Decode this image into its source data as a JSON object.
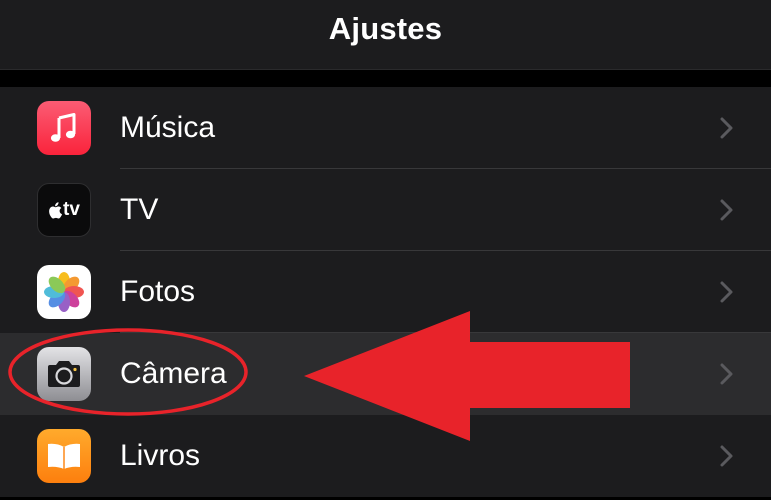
{
  "header": {
    "title": "Ajustes"
  },
  "settings": {
    "items": [
      {
        "label": "Música",
        "icon": "music-note-icon"
      },
      {
        "label": "TV",
        "icon": "apple-tv-icon",
        "icon_text": "tv"
      },
      {
        "label": "Fotos",
        "icon": "photos-flower-icon"
      },
      {
        "label": "Câmera",
        "icon": "camera-icon",
        "highlighted": true
      },
      {
        "label": "Livros",
        "icon": "open-book-icon"
      }
    ]
  },
  "annotation": {
    "shapes": [
      "red-ellipse",
      "red-arrow"
    ],
    "color": "#e8232a"
  },
  "colors": {
    "background": "#1c1c1e",
    "selected_row": "#2c2c2e",
    "separator": "#38383a",
    "chevron": "#5a5a5e"
  }
}
